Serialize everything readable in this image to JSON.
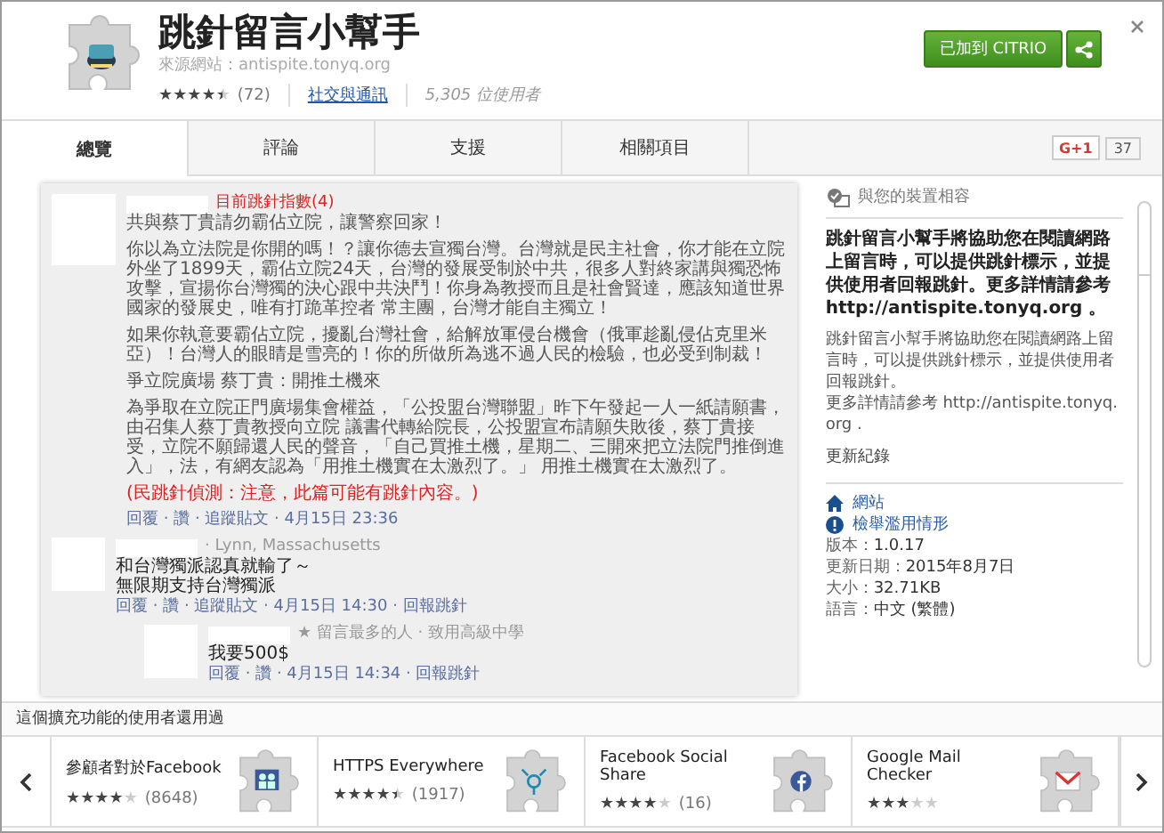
{
  "extension": {
    "title": "跳針留言小幫手",
    "source": "來源網站：antispite.tonyq.org",
    "rating": {
      "stars": 4.5,
      "count": "(72)"
    },
    "category": "社交與通訊",
    "users": "5,305 位使用者",
    "add_button": "已加到 CITRIO"
  },
  "tabs": [
    {
      "label": "總覽",
      "selected": true
    },
    {
      "label": "評論",
      "selected": false
    },
    {
      "label": "支援",
      "selected": false
    },
    {
      "label": "相關項目",
      "selected": false
    }
  ],
  "gplus": {
    "label": "G+1",
    "count": "37"
  },
  "screenshot": {
    "score": "目前跳針指數(4)",
    "paragraphs": [
      "共與蔡丁貴請勿霸佔立院，讓警察回家！",
      "你以為立法院是你開的嗎！？讓你德去宣獨台灣。台灣就是民主社會，你才能在立院外坐了1899天，霸佔立院24天，台灣的發展受制於中共，很多人對終家講與獨恐怖攻擊，宣揚你台灣獨的決心跟中共決鬥！你身為教授而且是社會賢達，應該知道世界國家的發展史，唯有打跪革控者 常主團，台灣才能自主獨立！",
      "如果你執意要霸佔立院，擾亂台灣社會，給解放軍侵台機會（俄軍趁亂侵佔克里米亞）！台灣人的眼睛是雪亮的！你的所做所為逃不過人民的檢驗，也必受到制裁！",
      "爭立院廣場 蔡丁貴：開推土機來",
      "為爭取在立院正門廣場集會權益，「公投盟台灣聯盟」昨下午發起一人一紙請願書，由召集人蔡丁貴教授向立院 議書代轉給院長，公投盟宣布請願失敗後，蔡丁貴接受，立院不願歸還人民的聲音，「自己買推土機，星期二、三開來把立法院門推倒進入」，法，有網友認為「用推土機實在太激烈了。」 用推土機實在太激烈了。"
    ],
    "warning": "(民跳針偵測：注意，此篇可能有跳針內容。)",
    "actions": "回覆 · 讚 · 追蹤貼文 · 4月15日 23:36",
    "comments": [
      {
        "author_detail": "· Lynn, Massachusetts",
        "lines": [
          "和台灣獨派認真就輸了～",
          "無限期支持台灣獨派"
        ],
        "actions": "回覆 · 讚 · 追蹤貼文 · 4月15日 14:30 · 回報跳針"
      },
      {
        "author_detail": "★ 留言最多的人 · 致用高級中學",
        "lines": [
          "我要500$"
        ],
        "actions": "回覆 · 讚 · 4月15日 14:34 · 回報跳針"
      }
    ]
  },
  "sidebar": {
    "compat": "與您的裝置相容",
    "summary": "跳針留言小幫手將協助您在閱讀網路上留言時，可以提供跳針標示，並提供使用者回報跳針。更多詳情請參考 http://antispite.tonyq.org 。",
    "description": [
      "跳針留言小幫手將協助您在閱讀網路上留言時，可以提供跳針標示，並提供使用者回報跳針。",
      "更多詳情請參考 http://antispite.tonyq.org ."
    ],
    "changelog": "更新紀錄",
    "links": [
      {
        "kind": "home",
        "label": "網站"
      },
      {
        "kind": "report",
        "label": "檢舉濫用情形"
      }
    ],
    "details": [
      {
        "label": "版本：",
        "value": "1.0.17"
      },
      {
        "label": "更新日期：",
        "value": "2015年8月7日"
      },
      {
        "label": "大小：",
        "value": "32.71KB"
      },
      {
        "label": "語言：",
        "value": "中文 (繁體)"
      }
    ]
  },
  "related": {
    "title": "這個擴充功能的使用者還用過",
    "items": [
      {
        "name": "參顧者對於Facebook",
        "stars": 4,
        "count": "(8648)",
        "kind": "people"
      },
      {
        "name": "HTTPS Everywhere",
        "stars": 4.5,
        "count": "(1917)",
        "kind": "network"
      },
      {
        "name": "Facebook Social Share",
        "stars": 4,
        "count": "(16)",
        "kind": "facebook"
      },
      {
        "name": "Google Mail Checker",
        "stars": 3,
        "kind": "mail"
      }
    ]
  }
}
